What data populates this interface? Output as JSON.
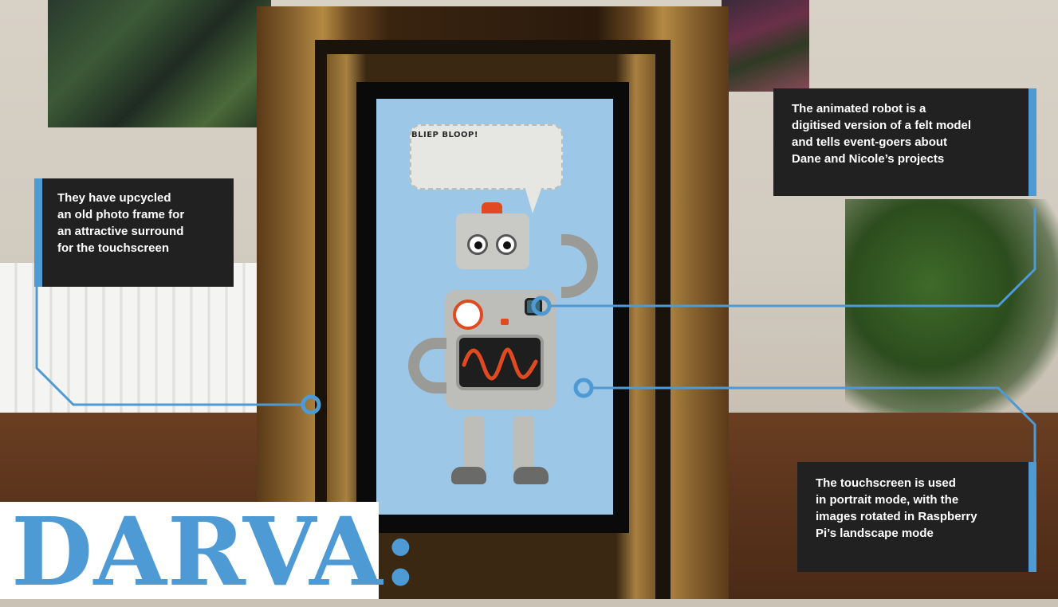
{
  "robot_speech": "BLIEP BLOOP!",
  "callouts": {
    "frame": "They have upcycled an old photo frame for an attractive surround for the touchscreen",
    "frame_lines": [
      "They have upcycled",
      "an old photo frame for",
      "an attractive surround",
      "for the touchscreen"
    ],
    "robot_lines": [
      "The animated robot is a",
      "digitised version of a felt model",
      "and tells event-goers about",
      "Dane and Nicole’s projects"
    ],
    "screen_lines": [
      "The touchscreen is used",
      "in portrait mode, with the",
      "images rotated in Raspberry",
      "Pi’s landscape mode"
    ]
  },
  "title": "DARVA:",
  "colors": {
    "accent": "#4e9ad5",
    "callout_bg": "#212121",
    "callout_text": "#ffffff"
  }
}
